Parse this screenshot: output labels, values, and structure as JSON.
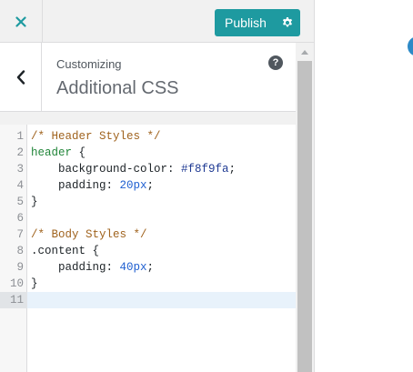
{
  "header": {
    "close_icon": "close-icon",
    "publish_label": "Publish",
    "settings_icon": "gear-icon",
    "accent_color": "#1e9aa0"
  },
  "section": {
    "back_icon": "chevron-left-icon",
    "breadcrumb": "Customizing",
    "title": "Additional CSS",
    "help_label": "?"
  },
  "editor": {
    "active_line": 11,
    "lines": [
      {
        "number": "1",
        "tokens": [
          {
            "text": "/* Header Styles */",
            "type": "comment"
          }
        ]
      },
      {
        "number": "2",
        "tokens": [
          {
            "text": "header",
            "type": "tag"
          },
          {
            "text": " {",
            "type": "plain"
          }
        ]
      },
      {
        "number": "3",
        "tokens": [
          {
            "text": "    background-color: ",
            "type": "plain"
          },
          {
            "text": "#f8f9fa",
            "type": "color"
          },
          {
            "text": ";",
            "type": "plain"
          }
        ]
      },
      {
        "number": "4",
        "tokens": [
          {
            "text": "    padding: ",
            "type": "plain"
          },
          {
            "text": "20px",
            "type": "number"
          },
          {
            "text": ";",
            "type": "plain"
          }
        ]
      },
      {
        "number": "5",
        "tokens": [
          {
            "text": "}",
            "type": "plain"
          }
        ]
      },
      {
        "number": "6",
        "tokens": []
      },
      {
        "number": "7",
        "tokens": [
          {
            "text": "/* Body Styles */",
            "type": "comment"
          }
        ]
      },
      {
        "number": "8",
        "tokens": [
          {
            "text": ".content {",
            "type": "plain"
          }
        ]
      },
      {
        "number": "9",
        "tokens": [
          {
            "text": "    padding: ",
            "type": "plain"
          },
          {
            "text": "40px",
            "type": "number"
          },
          {
            "text": ";",
            "type": "plain"
          }
        ]
      },
      {
        "number": "10",
        "tokens": [
          {
            "text": "}",
            "type": "plain"
          }
        ]
      },
      {
        "number": "11",
        "tokens": []
      }
    ]
  },
  "preview": {
    "indicator_color": "#2d8ac7"
  }
}
